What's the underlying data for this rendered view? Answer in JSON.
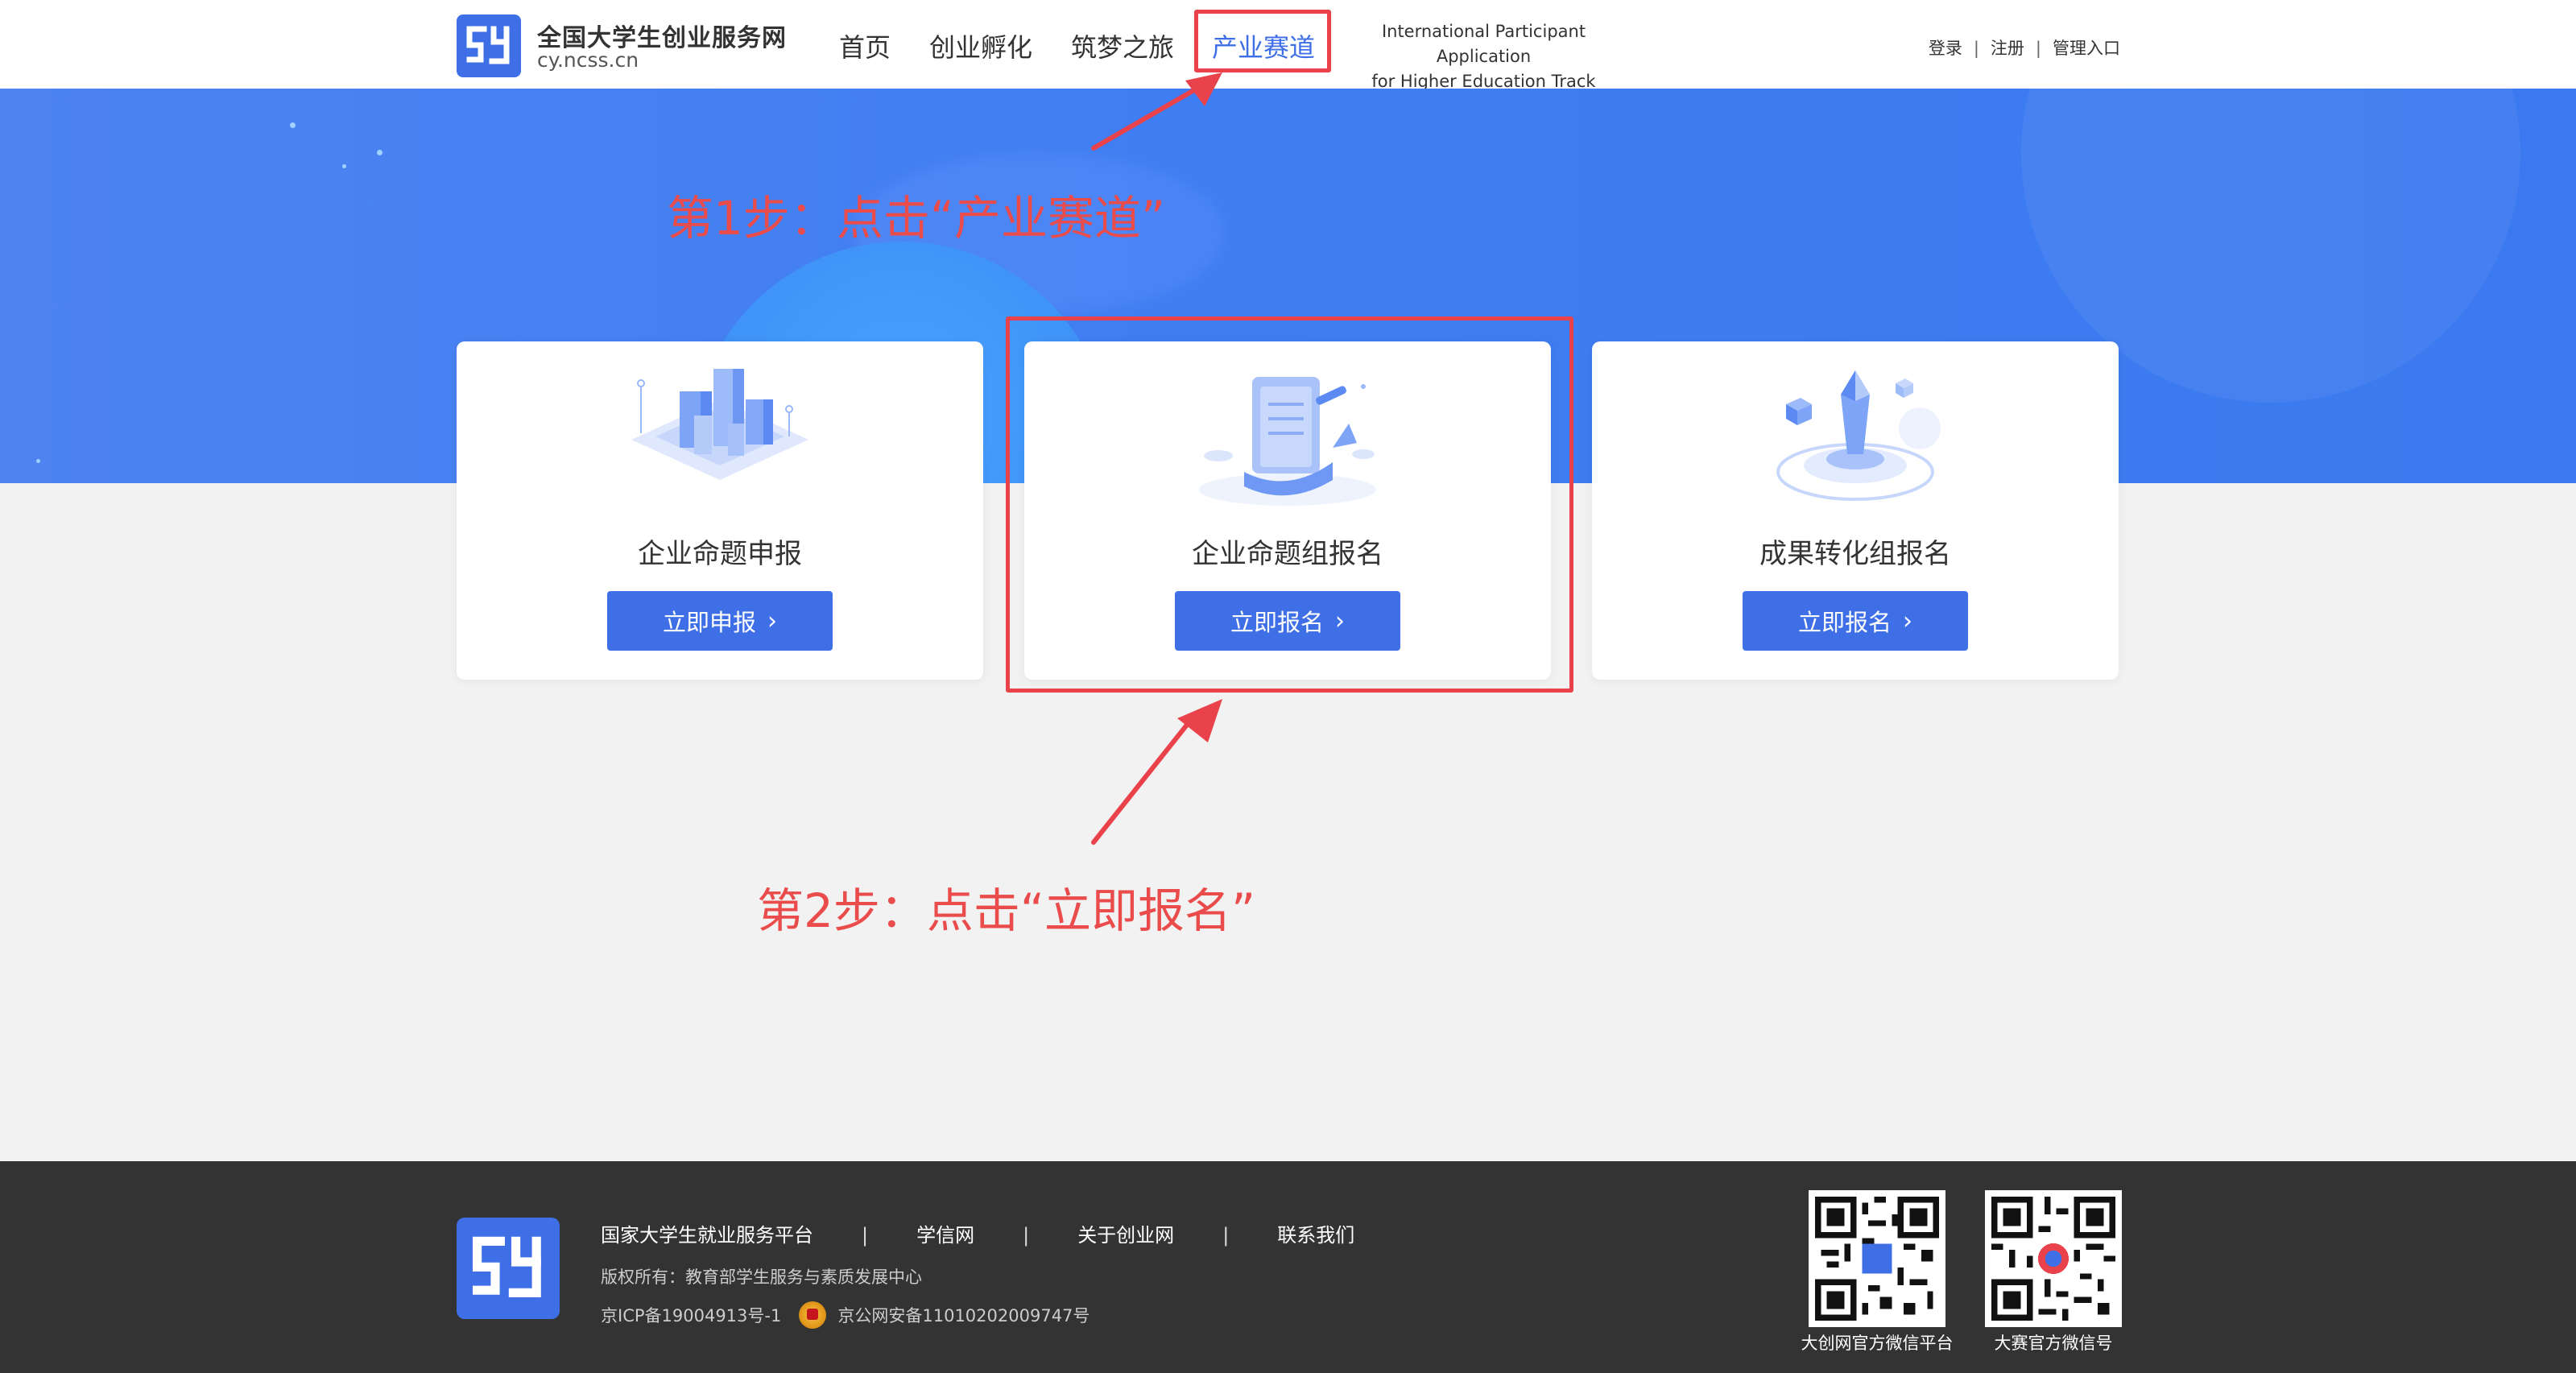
{
  "header": {
    "site_name": "全国大学生创业服务网",
    "site_domain": "cy.ncss.cn",
    "nav": [
      {
        "label": "首页"
      },
      {
        "label": "创业孵化"
      },
      {
        "label": "筑梦之旅"
      },
      {
        "label": "产业赛道",
        "active": true
      }
    ],
    "intl_line1": "International Participant Application",
    "intl_line2": "for Higher Education Track",
    "login": "登录",
    "register": "注册",
    "admin": "管理入口",
    "separator": "|"
  },
  "cards": [
    {
      "title": "企业命题申报",
      "button": "立即申报",
      "icon": "city-buildings-illustration"
    },
    {
      "title": "企业命题组报名",
      "button": "立即报名",
      "icon": "scroll-document-illustration"
    },
    {
      "title": "成果转化组报名",
      "button": "立即报名",
      "icon": "crystal-platform-illustration"
    }
  ],
  "annotations": {
    "step1": "第1步：点击“产业赛道”",
    "step2": "第2步：点击“立即报名”"
  },
  "footer": {
    "links": [
      "国家大学生就业服务平台",
      "学信网",
      "关于创业网",
      "联系我们"
    ],
    "separator": "|",
    "copyright": "版权所有：教育部学生服务与素质发展中心",
    "icp": "京ICP备19004913号-1",
    "police": "京公网安备11010202009747号",
    "qr1_label": "大创网官方微信平台",
    "qr2_label": "大赛官方微信号"
  },
  "colors": {
    "brand_blue": "#3e6fe6",
    "annotation_red": "#e9424a",
    "footer_bg": "#333333"
  }
}
